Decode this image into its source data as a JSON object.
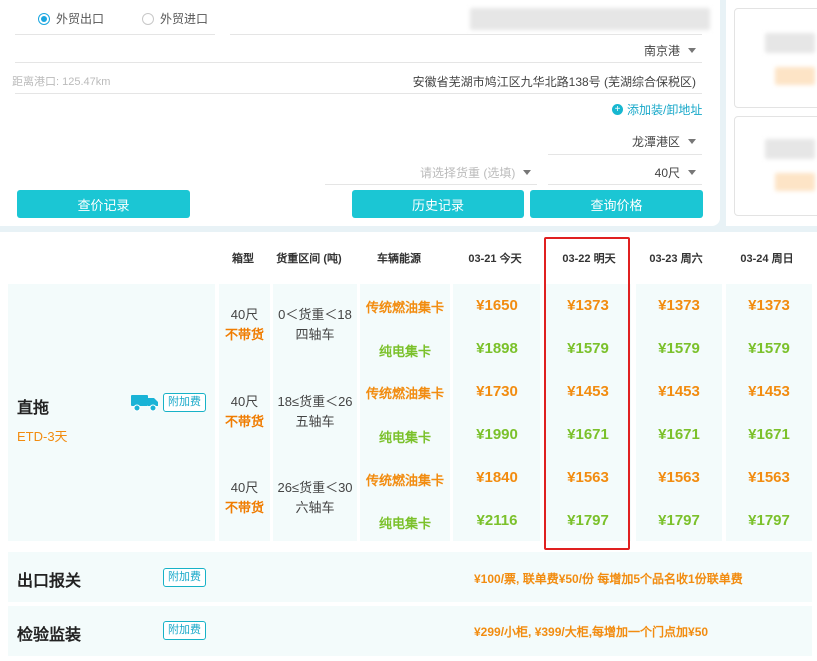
{
  "form": {
    "radio_export": "外贸出口",
    "radio_import": "外贸进口",
    "port": "南京港",
    "distance": "距离港口: 125.47km",
    "address": "安徽省芜湖市鸠江区九华北路138号 (芜湖综合保税区)",
    "add_address": "添加装/卸地址",
    "port_area": "龙潭港区",
    "weight_placeholder": "请选择货重 (选填)",
    "container_size": "40尺",
    "btn_price_records": "查价记录",
    "btn_history": "历史记录",
    "btn_query_price": "查询价格"
  },
  "table": {
    "headers": {
      "box_type": "箱型",
      "weight_range": "货重区间 (吨)",
      "energy": "车辆能源",
      "dates": [
        "03-21 今天",
        "03-22 明天",
        "03-23 周六",
        "03-24 周日"
      ]
    },
    "service": {
      "name": "直拖",
      "etd": "ETD-3天",
      "surcharge_label": "附加费"
    },
    "groups": [
      {
        "box": "40尺",
        "no_cargo": "不带货",
        "range": "0＜货重＜18",
        "axles": "四轴车",
        "rows": [
          {
            "energy": "传统燃油集卡",
            "type": "diesel",
            "prices": [
              "¥1650",
              "¥1373",
              "¥1373",
              "¥1373"
            ]
          },
          {
            "energy": "纯电集卡",
            "type": "electric",
            "prices": [
              "¥1898",
              "¥1579",
              "¥1579",
              "¥1579"
            ]
          }
        ]
      },
      {
        "box": "40尺",
        "no_cargo": "不带货",
        "range": "18≤货重＜26",
        "axles": "五轴车",
        "rows": [
          {
            "energy": "传统燃油集卡",
            "type": "diesel",
            "prices": [
              "¥1730",
              "¥1453",
              "¥1453",
              "¥1453"
            ]
          },
          {
            "energy": "纯电集卡",
            "type": "electric",
            "prices": [
              "¥1990",
              "¥1671",
              "¥1671",
              "¥1671"
            ]
          }
        ]
      },
      {
        "box": "40尺",
        "no_cargo": "不带货",
        "range": "26≤货重＜30",
        "axles": "六轴车",
        "rows": [
          {
            "energy": "传统燃油集卡",
            "type": "diesel",
            "prices": [
              "¥1840",
              "¥1563",
              "¥1563",
              "¥1563"
            ]
          },
          {
            "energy": "纯电集卡",
            "type": "electric",
            "prices": [
              "¥2116",
              "¥1797",
              "¥1797",
              "¥1797"
            ]
          }
        ]
      }
    ],
    "extras": [
      {
        "name": "出口报关",
        "surcharge_label": "附加费",
        "text": "¥100/票, 联单费¥50/份  每增加5个品名收1份联单费"
      },
      {
        "name": "检验监装",
        "surcharge_label": "附加费",
        "text": "¥299/小柜, ¥399/大柜,每增加一个门点加¥50"
      }
    ]
  },
  "colors": {
    "accent": "#1bc6d4",
    "diesel": "#f28c10",
    "electric": "#7bc12b",
    "highlight": "#e02020"
  }
}
